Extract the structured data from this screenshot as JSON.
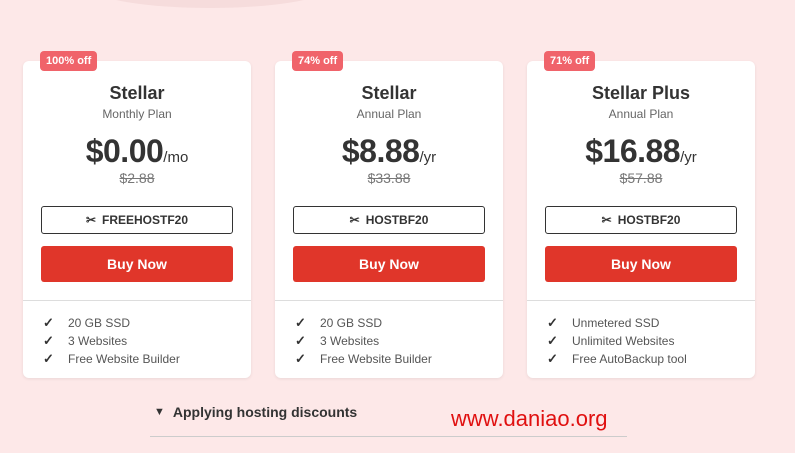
{
  "plans": [
    {
      "badge": "100% off",
      "name": "Stellar",
      "term": "Monthly Plan",
      "price": "$0.00",
      "period": "/mo",
      "old_price": "$2.88",
      "coupon": "FREEHOSTF20",
      "buy_label": "Buy Now",
      "features": [
        "20 GB SSD",
        "3 Websites",
        "Free Website Builder"
      ]
    },
    {
      "badge": "74% off",
      "name": "Stellar",
      "term": "Annual Plan",
      "price": "$8.88",
      "period": "/yr",
      "old_price": "$33.88",
      "coupon": "HOSTBF20",
      "buy_label": "Buy Now",
      "features": [
        "20 GB SSD",
        "3 Websites",
        "Free Website Builder"
      ]
    },
    {
      "badge": "71% off",
      "name": "Stellar Plus",
      "term": "Annual Plan",
      "price": "$16.88",
      "period": "/yr",
      "old_price": "$57.88",
      "coupon": "HOSTBF20",
      "buy_label": "Buy Now",
      "features": [
        "Unmetered SSD",
        "Unlimited Websites",
        "Free AutoBackup tool"
      ]
    }
  ],
  "icons": {
    "coupon": "scissors-icon",
    "feature": "check-icon",
    "accordion": "chevron-down-icon"
  },
  "accordion": {
    "label": "Applying hosting discounts"
  },
  "watermark": "www.daniao.org",
  "colors": {
    "background": "#fde8e8",
    "badge": "#f0636a",
    "buy_button": "#e0362a",
    "watermark": "#e01010"
  }
}
